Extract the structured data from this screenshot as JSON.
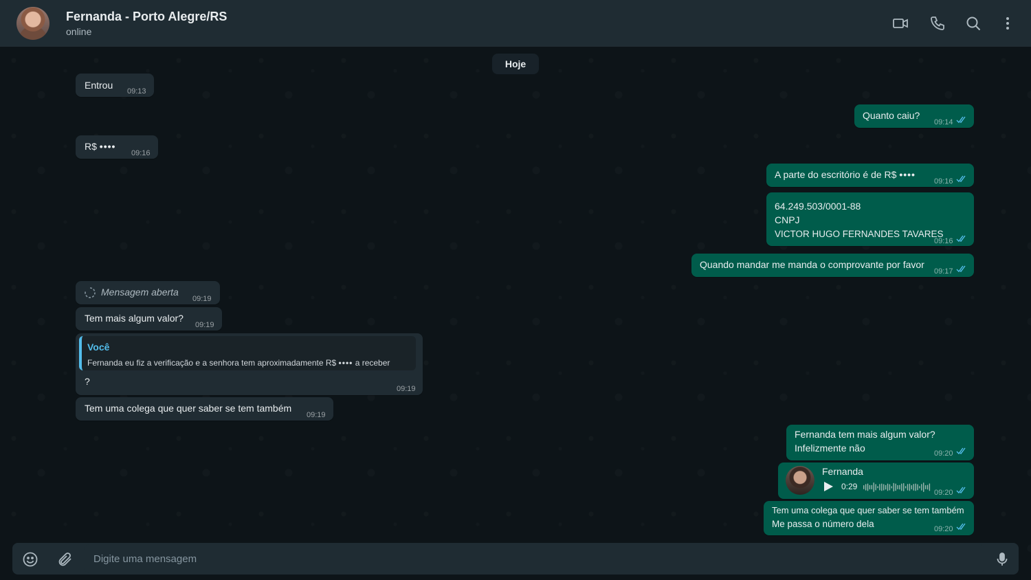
{
  "header": {
    "contact_name": "Fernanda - Porto Alegre/RS",
    "status": "online",
    "icons": [
      "video-call-icon",
      "phone-call-icon",
      "search-icon",
      "menu-icon"
    ]
  },
  "date_divider": "Hoje",
  "messages": [
    {
      "direction": "in",
      "text": "Entrou",
      "time": "09:13"
    },
    {
      "direction": "out",
      "text": "Quanto caiu?",
      "time": "09:14",
      "status": "read"
    },
    {
      "direction": "in",
      "text": "R$",
      "masked": "••••",
      "time": "09:16"
    },
    {
      "direction": "out",
      "text": "A parte do escritório é de R$",
      "masked": "••••",
      "time": "09:16",
      "status": "read"
    },
    {
      "direction": "out",
      "lines": [
        "64.249.503/0001-88",
        "CNPJ",
        "VICTOR HUGO FERNANDES TAVARES"
      ],
      "time": "09:16",
      "status": "read"
    },
    {
      "direction": "out",
      "text": "Quando mandar me manda o comprovante por favor",
      "time": "09:17",
      "status": "read"
    },
    {
      "direction": "in",
      "type": "view-once-opened",
      "text": "Mensagem aberta",
      "time": "09:19"
    },
    {
      "direction": "in",
      "text": "Tem mais algum valor?",
      "time": "09:19"
    },
    {
      "direction": "in",
      "reply_to": {
        "author": "Você",
        "text": "Fernanda eu fiz a verificação e a senhora tem aproximadamente R$",
        "masked": "••••",
        "text_after": "a receber"
      },
      "text": "?",
      "time": "09:19"
    },
    {
      "direction": "in",
      "text": "Tem uma colega que quer saber se tem também",
      "time": "09:19"
    },
    {
      "direction": "out",
      "lines": [
        "Fernanda tem mais algum valor?",
        "Infelizmente não"
      ],
      "time": "09:20",
      "status": "read"
    },
    {
      "direction": "out",
      "type": "voice",
      "sender": "Fernanda",
      "duration": "0:29",
      "time": "09:20",
      "status": "read"
    },
    {
      "direction": "out",
      "lines": [
        "Tem uma colega que quer saber se tem também",
        "Me passa o número dela"
      ],
      "time": "09:20",
      "status": "read"
    }
  ],
  "composer": {
    "placeholder": "Digite uma mensagem",
    "icons": [
      "emoji-icon",
      "attach-icon",
      "microphone-icon"
    ]
  },
  "colors": {
    "header_bg": "#1f2c33",
    "chat_bg": "#0d1418",
    "incoming_bubble": "#202c33",
    "outgoing_bubble": "#005c4b",
    "read_tick": "#53bdeb",
    "reply_accent": "#53bdeb"
  }
}
